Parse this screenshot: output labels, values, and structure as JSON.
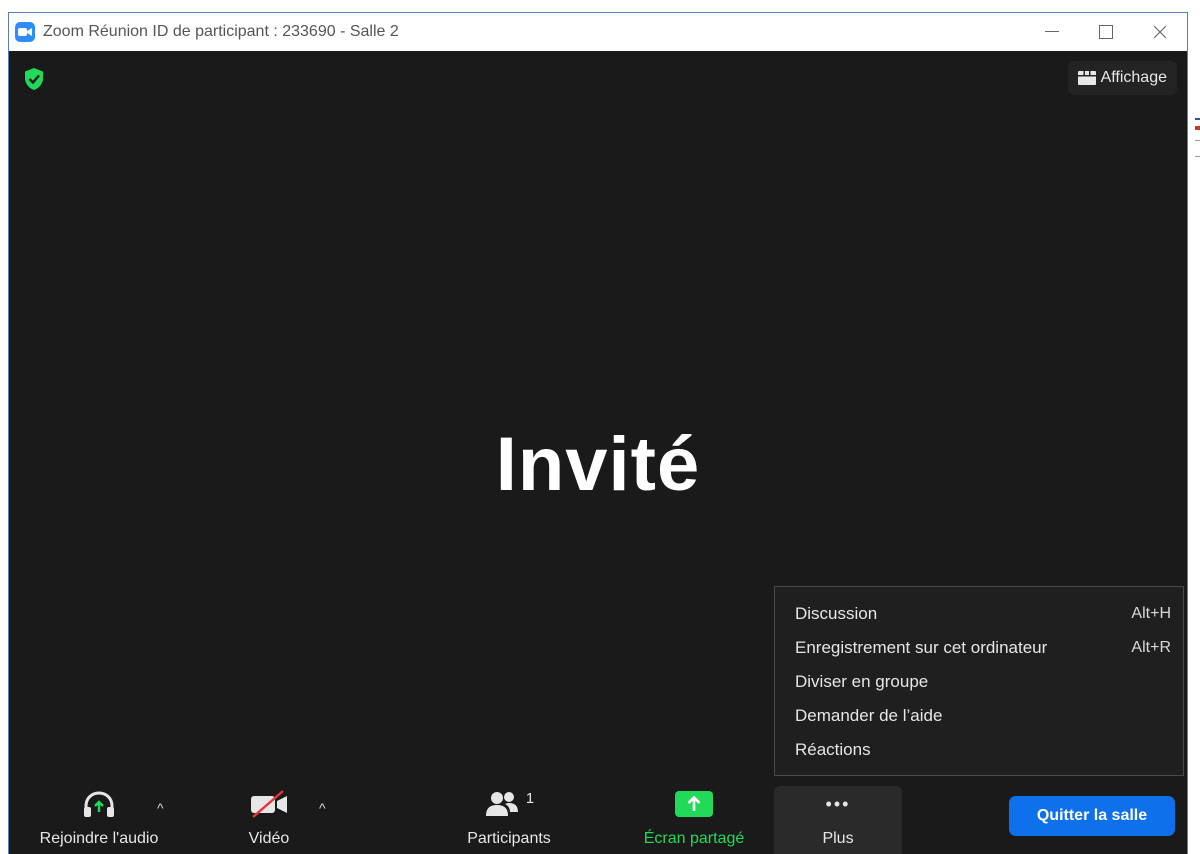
{
  "window": {
    "title": "Zoom Réunion ID de participant : 233690 - Salle 2",
    "controls": [
      "minimize",
      "maximize",
      "close"
    ]
  },
  "stage": {
    "participant_name": "Invité",
    "view_label": "Affichage",
    "security_icon": "shield-check-icon"
  },
  "more_menu": {
    "items": [
      {
        "label": "Discussion",
        "shortcut": "Alt+H"
      },
      {
        "label": "Enregistrement sur cet ordinateur",
        "shortcut": "Alt+R"
      },
      {
        "label": "Diviser en groupe",
        "shortcut": ""
      },
      {
        "label": "Demander de l’aide",
        "shortcut": ""
      },
      {
        "label": "Réactions",
        "shortcut": ""
      }
    ]
  },
  "toolbar": {
    "audio_label": "Rejoindre l'audio",
    "video_label": "Vidéo",
    "participants_label": "Participants",
    "participants_count": "1",
    "share_label": "Écran partagé",
    "more_label": "Plus",
    "more_icon": "•••",
    "leave_label": "Quitter la salle"
  },
  "colors": {
    "accent_blue": "#0e71eb",
    "share_green": "#23d959",
    "shield_green": "#23d959",
    "stage_bg": "#1a1a1a"
  }
}
